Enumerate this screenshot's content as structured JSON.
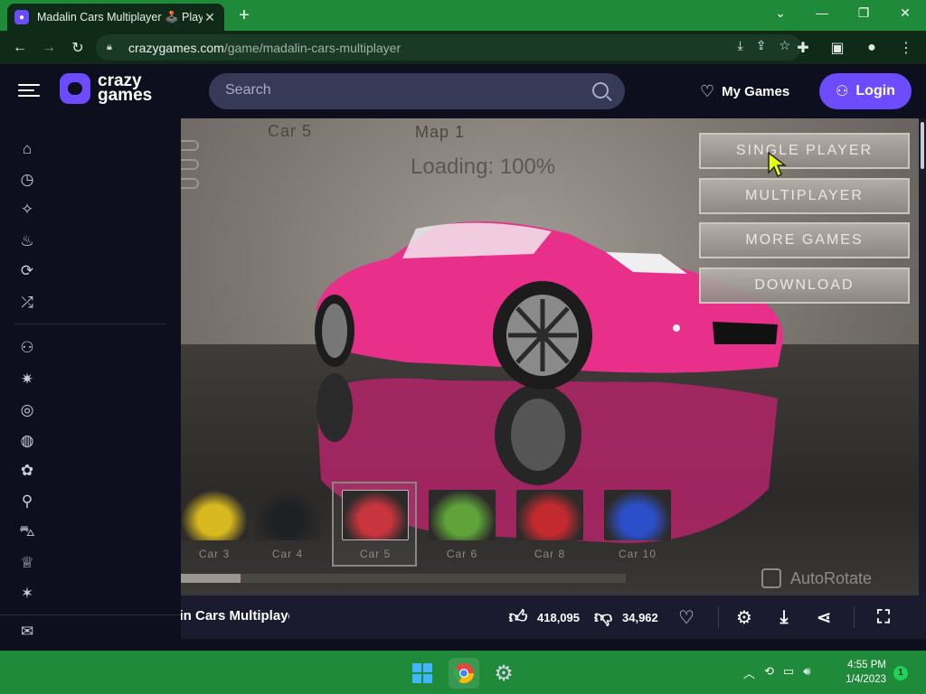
{
  "browser": {
    "tab_title": "Madalin Cars Multiplayer 🕹️ Play",
    "url_domain": "crazygames.com",
    "url_path": "/game/madalin-cars-multiplayer"
  },
  "site": {
    "logo_line1": "crazy",
    "logo_line2": "games",
    "search_placeholder": "Search",
    "my_games": "My Games",
    "login": "Login"
  },
  "sidebar": {
    "items": [
      {
        "icon": "home-icon",
        "glyph": "⌂"
      },
      {
        "icon": "clock-icon",
        "glyph": "◷"
      },
      {
        "icon": "sparkle-icon",
        "glyph": "✧"
      },
      {
        "icon": "flame-icon",
        "glyph": "♨"
      },
      {
        "icon": "refresh-icon",
        "glyph": "⟳"
      },
      {
        "icon": "shuffle-icon",
        "glyph": "⤮"
      },
      {
        "icon": "two-player-icon",
        "glyph": "⚇"
      },
      {
        "icon": "action-icon",
        "glyph": "✷"
      },
      {
        "icon": "compass-icon",
        "glyph": "◎"
      },
      {
        "icon": "basketball-icon",
        "glyph": "◍"
      },
      {
        "icon": "flower-icon",
        "glyph": "✿"
      },
      {
        "icon": "bike-icon",
        "glyph": "⚲"
      },
      {
        "icon": "car-icon",
        "glyph": "⛍"
      },
      {
        "icon": "joystick-icon",
        "glyph": "♕"
      },
      {
        "icon": "magic-icon",
        "glyph": "✶"
      }
    ],
    "bottom_icon": "mail-icon"
  },
  "game": {
    "car_label": "Car 5",
    "map_label": "Map 1",
    "loading": "Loading: 100%",
    "menu": [
      "SINGLE PLAYER",
      "MULTIPLAYER",
      "MORE GAMES",
      "DOWNLOAD"
    ],
    "cars": [
      {
        "label": "Car 3",
        "color": "#d8b81f"
      },
      {
        "label": "Car 4",
        "color": "#1e2124"
      },
      {
        "label": "Car 5",
        "color": "#c9353f"
      },
      {
        "label": "Car 6",
        "color": "#5fa33a"
      },
      {
        "label": "Car 8",
        "color": "#c22a30"
      },
      {
        "label": "Car 10",
        "color": "#2c4fc9"
      }
    ],
    "autorotate": "AutoRotate",
    "car_color": "#e8308a"
  },
  "gamebar": {
    "title": "Madalin Cars Multiplayer",
    "likes": "418,095",
    "dislikes": "34,962"
  },
  "taskbar": {
    "time": "4:55 PM",
    "date": "1/4/2023",
    "notifications": "1"
  }
}
